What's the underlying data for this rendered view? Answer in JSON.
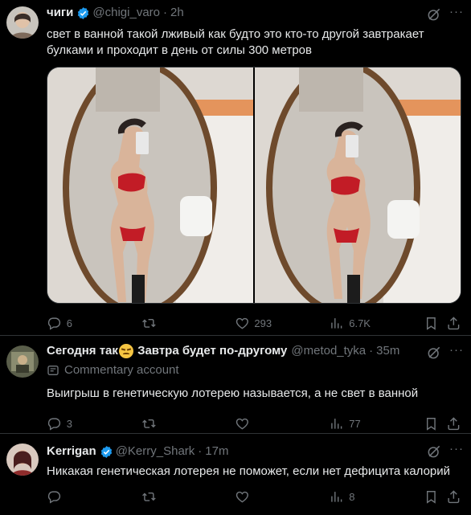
{
  "tweet1": {
    "name": "чиги",
    "handle": "@chigi_varo",
    "time": "2h",
    "text": "свет в ванной такой лживый как будто это кто-то другой завтракает булками и проходит в день от силы 300 метров",
    "replies": "6",
    "retweets": "",
    "likes": "293",
    "views": "6.7K"
  },
  "tweet2": {
    "name": "Сегодня так",
    "name_suffix": "Завтра будет по-другому",
    "handle": "@metod_tyka",
    "time": "35m",
    "label": "Commentary account",
    "text": "Выигрыш в генетическую лотерею называется, а не свет в ванной",
    "replies": "3",
    "retweets": "",
    "likes": "",
    "views": "77"
  },
  "tweet3": {
    "name": "Kerrigan",
    "handle": "@Kerry_Shark",
    "time": "17m",
    "text": "Никакая генетическая лотерея не поможет, если нет дефицита калорий",
    "replies": "",
    "retweets": "",
    "likes": "",
    "views": "8"
  },
  "icons": {
    "reply": "reply-icon",
    "retweet": "retweet-icon",
    "like": "heart-icon",
    "views": "views-icon",
    "bookmark": "bookmark-icon",
    "share": "share-icon",
    "verified": "verified-badge-icon",
    "grok": "grok-icon",
    "more": "more-icon",
    "label": "commentary-label-icon"
  },
  "colors": {
    "background": "#000000",
    "text": "#e7e9ea",
    "secondary": "#71767b",
    "verified": "#1d9bf0",
    "divider": "#2f3336"
  }
}
